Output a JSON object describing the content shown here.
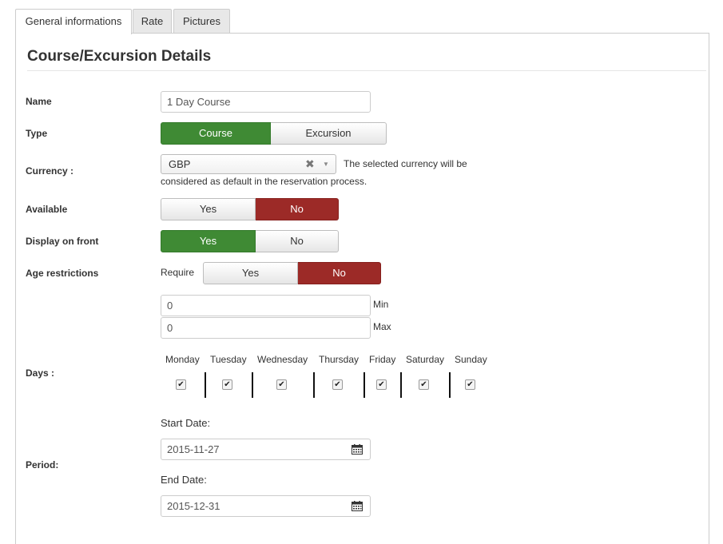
{
  "tabs": [
    "General informations",
    "Rate",
    "Pictures"
  ],
  "title": "Course/Excursion Details",
  "name": {
    "label": "Name",
    "value": "1 Day Course"
  },
  "type": {
    "label": "Type",
    "options": [
      "Course",
      "Excursion"
    ],
    "selected": "Course"
  },
  "currency": {
    "label": "Currency :",
    "value": "GBP",
    "help_line1": "The selected currency will be",
    "help_line2": "considered as default in the reservation process."
  },
  "available": {
    "label": "Available",
    "options": [
      "Yes",
      "No"
    ],
    "selected": "No"
  },
  "display_on_front": {
    "label": "Display on front",
    "options": [
      "Yes",
      "No"
    ],
    "selected": "Yes"
  },
  "age_restrictions": {
    "label": "Age restrictions",
    "require_label": "Require",
    "options": [
      "Yes",
      "No"
    ],
    "selected": "No",
    "min_value": "0",
    "min_label": "Min",
    "max_value": "0",
    "max_label": "Max"
  },
  "days": {
    "label": "Days :",
    "names": [
      "Monday",
      "Tuesday",
      "Wednesday",
      "Thursday",
      "Friday",
      "Saturday",
      "Sunday"
    ],
    "checked": [
      true,
      true,
      true,
      true,
      true,
      true,
      true
    ]
  },
  "period": {
    "label": "Period:",
    "start_label": "Start Date:",
    "start_value": "2015-11-27",
    "end_label": "End Date:",
    "end_value": "2015-12-31"
  },
  "colors": {
    "green": "#3f8a34",
    "red": "#9c2a27"
  },
  "icons": {
    "clear": "close-icon",
    "dropdown": "chevron-down-icon",
    "calendar": "calendar-icon",
    "check": "check-icon"
  }
}
